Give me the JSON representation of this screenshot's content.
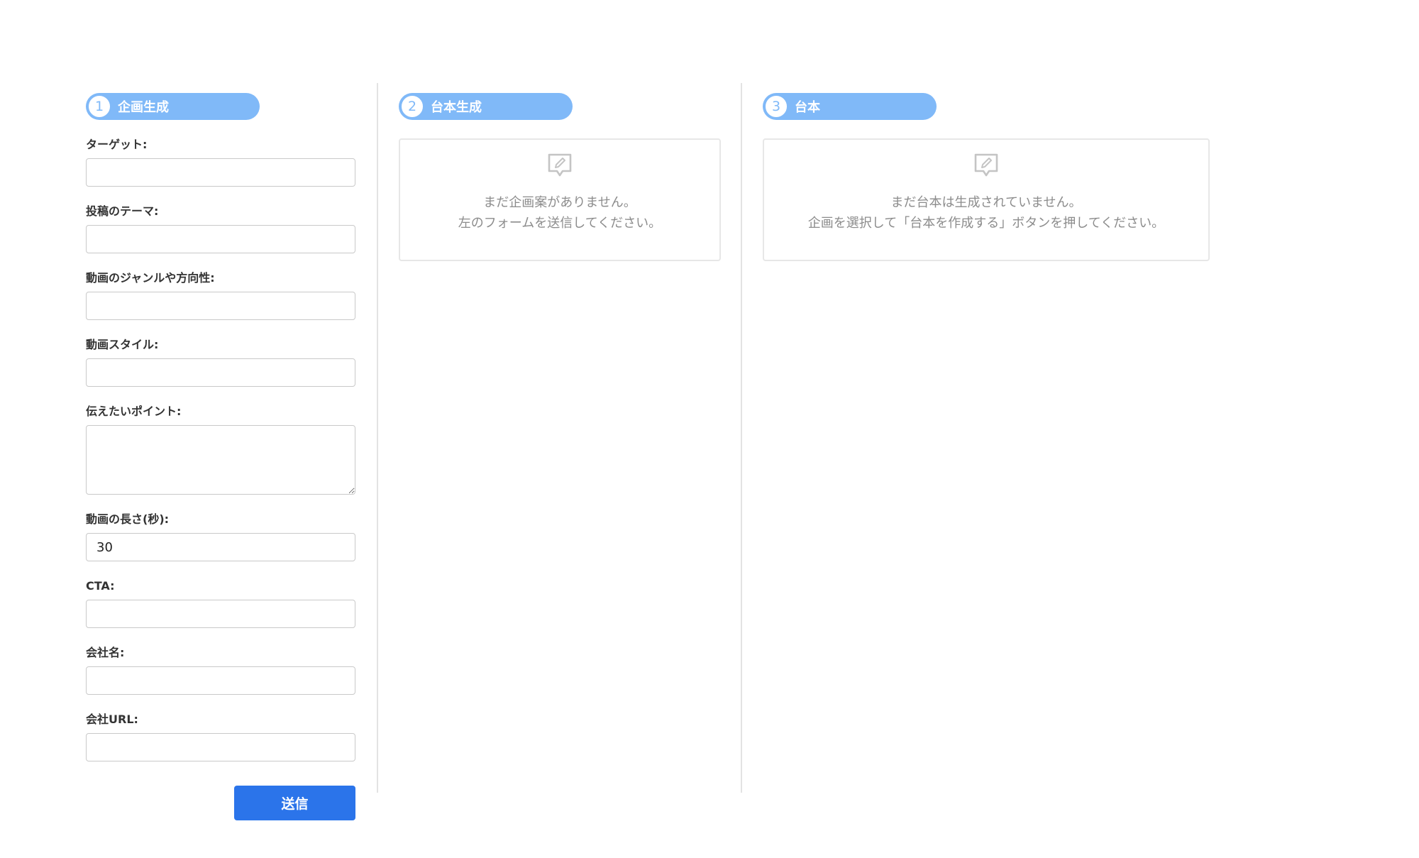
{
  "steps": [
    {
      "number": "1",
      "label": "企画生成"
    },
    {
      "number": "2",
      "label": "台本生成"
    },
    {
      "number": "3",
      "label": "台本"
    }
  ],
  "form": {
    "target_label": "ターゲット:",
    "target_value": "",
    "theme_label": "投稿のテーマ:",
    "theme_value": "",
    "genre_label": "動画のジャンルや方向性:",
    "genre_value": "",
    "style_label": "動画スタイル:",
    "style_value": "",
    "points_label": "伝えたいポイント:",
    "points_value": "",
    "length_label": "動画の長さ(秒):",
    "length_value": "30",
    "cta_label": "CTA:",
    "cta_value": "",
    "company_label": "会社名:",
    "company_value": "",
    "url_label": "会社URL:",
    "url_value": "",
    "submit_label": "送信"
  },
  "plans_panel": {
    "empty_line1": "まだ企画案がありません。",
    "empty_line2": "左のフォームを送信してください。"
  },
  "script_panel": {
    "empty_line1": "まだ台本は生成されていません。",
    "empty_line2": "企画を選択して「台本を作成する」ボタンを押してください。"
  },
  "icons": {
    "empty_state": "edit-note-icon"
  },
  "colors": {
    "step_pill": "#80b9f8",
    "primary_button": "#2b74ea",
    "empty_text": "#8c8c8c"
  }
}
